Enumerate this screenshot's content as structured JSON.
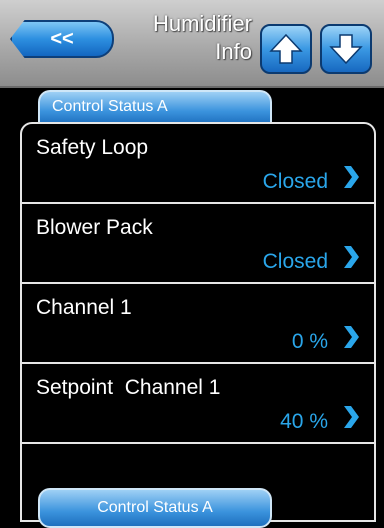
{
  "header": {
    "back_label": "<<",
    "title_line1": "Humidifier",
    "title_line2": "Info"
  },
  "tab": {
    "label": "Control Status A"
  },
  "rows": [
    {
      "label": "Safety Loop",
      "value": "Closed"
    },
    {
      "label": "Blower Pack",
      "value": "Closed"
    },
    {
      "label": "Channel 1",
      "value": "0 %"
    },
    {
      "label": "Setpoint  Channel 1",
      "value": "40 %"
    }
  ],
  "footer": {
    "button_label": "Control Status A"
  },
  "colors": {
    "accent": "#2aa6ea",
    "background": "#000000",
    "header": "#a9a9a9"
  },
  "icons": {
    "back": "back-arrow-icon",
    "up": "arrow-up-icon",
    "down": "arrow-down-icon",
    "chevron": "chevron-right-icon"
  }
}
